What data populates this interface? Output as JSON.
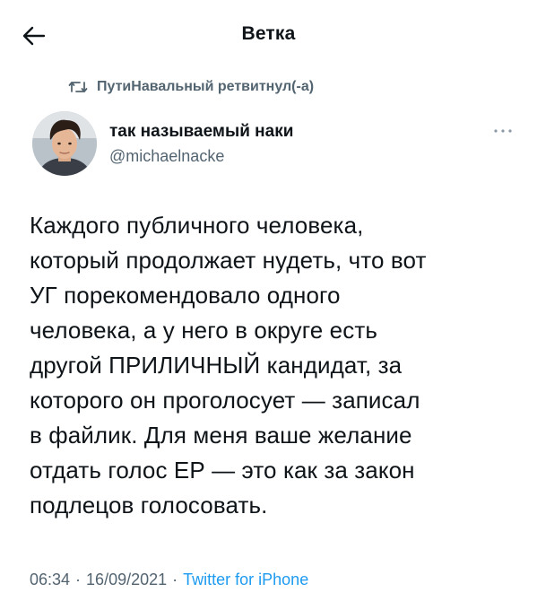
{
  "header": {
    "title": "Ветка",
    "back_icon": "arrow-left-icon"
  },
  "retweet": {
    "icon": "retweet-icon",
    "text": "ПутиНавальный ретвитнул(-а)"
  },
  "author": {
    "name": "так называемый наки",
    "handle": "@michaelnacke",
    "avatar_icon": "avatar-photo"
  },
  "more_icon": "more-dots-icon",
  "tweet": {
    "text": "Каждого публичного человека,\nкоторый продолжает нудеть, что вот\nУГ порекомендовало одного\nчеловека, а у него в округе есть\nдругой ПРИЛИЧНЫЙ кандидат, за\nкоторого он проголосует — записал\nв файлик. Для меня ваше желание\nотдать голос ЕР — это как за закон\nподлецов голосовать."
  },
  "meta": {
    "time": "06:34",
    "separator": "·",
    "date": "16/09/2021",
    "source": "Twitter for iPhone"
  },
  "colors": {
    "text": "#0f1419",
    "secondary": "#536471",
    "link": "#1d9bf0"
  }
}
